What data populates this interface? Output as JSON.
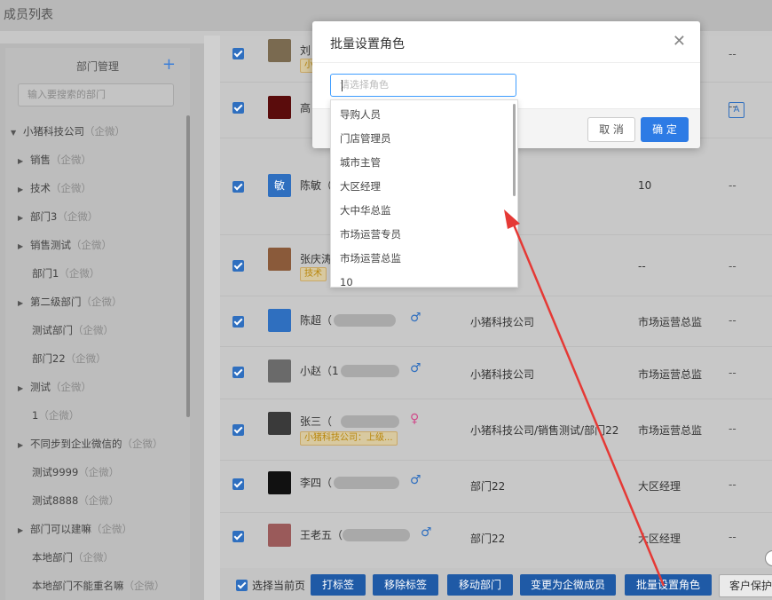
{
  "page_title": "成员列表",
  "sidebar": {
    "header": "部门管理",
    "add_icon": "plus-icon",
    "search_placeholder": "输入要搜索的部门",
    "tree": [
      {
        "label": "小猪科技公司",
        "tag": "（企微）",
        "arrow": "▼",
        "indent": 0
      },
      {
        "label": "销售",
        "tag": "（企微）",
        "arrow": "▶",
        "indent": 1
      },
      {
        "label": "技术",
        "tag": "（企微）",
        "arrow": "▶",
        "indent": 1
      },
      {
        "label": "部门3",
        "tag": "（企微）",
        "arrow": "▶",
        "indent": 1
      },
      {
        "label": "销售测试",
        "tag": "（企微）",
        "arrow": "▶",
        "indent": 1
      },
      {
        "label": "部门1",
        "tag": "（企微）",
        "arrow": "",
        "indent": 1
      },
      {
        "label": "第二级部门",
        "tag": "（企微）",
        "arrow": "▶",
        "indent": 1
      },
      {
        "label": "测试部门",
        "tag": "（企微）",
        "arrow": "",
        "indent": 1
      },
      {
        "label": "部门22",
        "tag": "（企微）",
        "arrow": "",
        "indent": 1
      },
      {
        "label": "测试",
        "tag": "（企微）",
        "arrow": "▶",
        "indent": 1
      },
      {
        "label": "1",
        "tag": "（企微）",
        "arrow": "",
        "indent": 1
      },
      {
        "label": "不同步到企业微信的",
        "tag": "（企微）",
        "arrow": "▶",
        "indent": 1
      },
      {
        "label": "测试9999",
        "tag": "（企微）",
        "arrow": "",
        "indent": 1
      },
      {
        "label": "测试8888",
        "tag": "（企微）",
        "arrow": "",
        "indent": 1
      },
      {
        "label": "部门可以建嘛",
        "tag": "（企微）",
        "arrow": "▶",
        "indent": 1
      },
      {
        "label": "本地部门",
        "tag": "（企微）",
        "arrow": "",
        "indent": 1
      },
      {
        "label": "本地部门不能重名嘛",
        "tag": "（企微）",
        "arrow": "",
        "indent": 1
      }
    ]
  },
  "table": {
    "rows": [
      {
        "name": "刘",
        "badge": "小",
        "dept": "",
        "role": "",
        "dash": "--"
      },
      {
        "name": "高",
        "badge": "",
        "dept": "",
        "role": "",
        "dash": "--",
        "extra_badge": "A"
      },
      {
        "name": "陈敏（",
        "avatar_text": "敏",
        "dept": "",
        "role": "10",
        "dash": "--"
      },
      {
        "name": "张庆涛",
        "badge": "技术",
        "dept": "",
        "role": "--",
        "dash": "--"
      },
      {
        "name": "陈超（",
        "sex": "♂",
        "dept": "小猪科技公司",
        "role": "市场运营总监",
        "dash": "--"
      },
      {
        "name": "小赵（1",
        "sex": "♂",
        "dept": "小猪科技公司",
        "role": "市场运营总监",
        "dash": "--"
      },
      {
        "name": "张三（",
        "sex": "♀",
        "badge": "小猪科技公司：上级...",
        "dept": "小猪科技公司/销售测试/部门22",
        "role": "市场运营总监",
        "dash": "--"
      },
      {
        "name": "李四（",
        "sex": "♂",
        "dept": "部门22",
        "role": "大区经理",
        "dash": "--"
      },
      {
        "name": "王老五（",
        "sex": "♂",
        "dept": "部门22",
        "role": "大区经理",
        "dash": "--"
      }
    ]
  },
  "footer": {
    "select_page": "选择当前页",
    "buttons": [
      "打标签",
      "移除标签",
      "移动部门",
      "变更为企微成员",
      "批量设置角色"
    ],
    "last_button": "客户保护"
  },
  "dialog": {
    "title": "批量设置角色",
    "close_icon": "close-icon",
    "input_placeholder": "请选择角色",
    "cancel": "取 消",
    "ok": "确 定",
    "options": [
      "导购人员",
      "门店管理员",
      "城市主管",
      "大区经理",
      "大中华总监",
      "市场运营专员",
      "市场运营总监",
      "10"
    ]
  },
  "colors": {
    "primary": "#2d7be5",
    "annotation_arrow": "#e53935"
  }
}
